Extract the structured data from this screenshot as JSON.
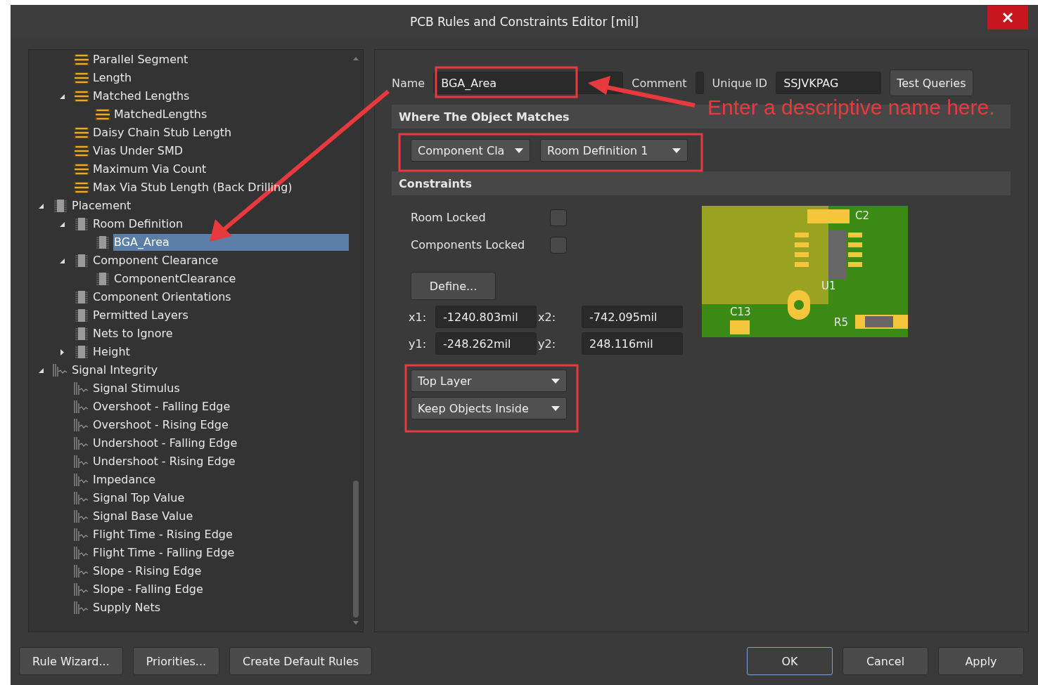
{
  "window": {
    "title": "PCB Rules and Constraints Editor [mil]"
  },
  "tree": {
    "items": [
      {
        "children": [
          {
            "label": "Parallel Segment",
            "kind": "routing",
            "selected": false
          },
          {
            "label": "Length",
            "kind": "routing",
            "selected": false
          },
          {
            "label": "Matched Lengths",
            "kind": "routing",
            "selected": false,
            "expanded": true,
            "children": [
              {
                "label": "MatchedLengths",
                "kind": "routing",
                "selected": false
              }
            ]
          },
          {
            "label": "Daisy Chain Stub Length",
            "kind": "routing",
            "selected": false
          },
          {
            "label": "Vias Under SMD",
            "kind": "routing",
            "selected": false
          },
          {
            "label": "Maximum Via Count",
            "kind": "routing",
            "selected": false
          },
          {
            "label": "Max Via Stub Length (Back Drilling)",
            "kind": "routing",
            "selected": false
          }
        ]
      },
      {
        "label": "Placement",
        "kind": "placement",
        "selected": false,
        "expanded": true,
        "children": [
          {
            "label": "Room Definition",
            "kind": "placement",
            "selected": false,
            "expanded": true,
            "children": [
              {
                "label": "BGA_Area",
                "kind": "placement",
                "selected": true
              }
            ]
          },
          {
            "label": "Component Clearance",
            "kind": "placement",
            "selected": false,
            "expanded": true,
            "children": [
              {
                "label": "ComponentClearance",
                "kind": "placement",
                "selected": false
              }
            ]
          },
          {
            "label": "Component Orientations",
            "kind": "placement",
            "selected": false
          },
          {
            "label": "Permitted Layers",
            "kind": "placement",
            "selected": false
          },
          {
            "label": "Nets to Ignore",
            "kind": "placement",
            "selected": false
          },
          {
            "label": "Height",
            "kind": "placement",
            "selected": false,
            "expanded": false
          }
        ]
      },
      {
        "label": "Signal Integrity",
        "kind": "signal",
        "selected": false,
        "expanded": true,
        "children": [
          {
            "label": "Signal Stimulus",
            "kind": "signal",
            "selected": false
          },
          {
            "label": "Overshoot - Falling Edge",
            "kind": "signal",
            "selected": false
          },
          {
            "label": "Overshoot - Rising Edge",
            "kind": "signal",
            "selected": false
          },
          {
            "label": "Undershoot - Falling Edge",
            "kind": "signal",
            "selected": false
          },
          {
            "label": "Undershoot - Rising Edge",
            "kind": "signal",
            "selected": false
          },
          {
            "label": "Impedance",
            "kind": "signal",
            "selected": false
          },
          {
            "label": "Signal Top Value",
            "kind": "signal",
            "selected": false
          },
          {
            "label": "Signal Base Value",
            "kind": "signal",
            "selected": false
          },
          {
            "label": "Flight Time - Rising Edge",
            "kind": "signal",
            "selected": false
          },
          {
            "label": "Flight Time - Falling Edge",
            "kind": "signal",
            "selected": false
          },
          {
            "label": "Slope - Rising Edge",
            "kind": "signal",
            "selected": false
          },
          {
            "label": "Slope - Falling Edge",
            "kind": "signal",
            "selected": false
          },
          {
            "label": "Supply Nets",
            "kind": "signal",
            "selected": false
          }
        ]
      }
    ]
  },
  "rule": {
    "name_label": "Name",
    "name": "BGA_Area",
    "comment_label": "Comment",
    "unique_id_label": "Unique ID",
    "unique_id": "SSJVKPAG",
    "test_button": "Test Queries",
    "match_header": "Where The Object Matches",
    "match_dropdowns": [
      "Component Cla",
      "Room Definition 1"
    ],
    "constraints_header": "Constraints",
    "checkboxes": [
      {
        "label": "Room Locked",
        "checked": false
      },
      {
        "label": "Components Locked",
        "checked": false
      }
    ],
    "define_button": "Define...",
    "coords": [
      {
        "label": "x1:",
        "value": "-1240.803mil"
      },
      {
        "label": "x2:",
        "value": "-742.095mil"
      },
      {
        "label": "y1:",
        "value": "-248.262mil"
      },
      {
        "label": "y2:",
        "value": "248.116mil"
      }
    ],
    "layer_dropdowns": [
      "Top Layer",
      "Keep Objects Inside"
    ],
    "preview_labels": [
      "C2",
      "U1",
      "C13",
      "R5"
    ]
  },
  "annotation": {
    "text": "Enter a descriptive name here."
  },
  "buttons_left": [
    "Rule Wizard...",
    "Priorities...",
    "Create Default Rules"
  ],
  "buttons_right": [
    {
      "label": "OK",
      "default": true
    },
    {
      "label": "Cancel",
      "default": false
    },
    {
      "label": "Apply",
      "default": false
    }
  ]
}
